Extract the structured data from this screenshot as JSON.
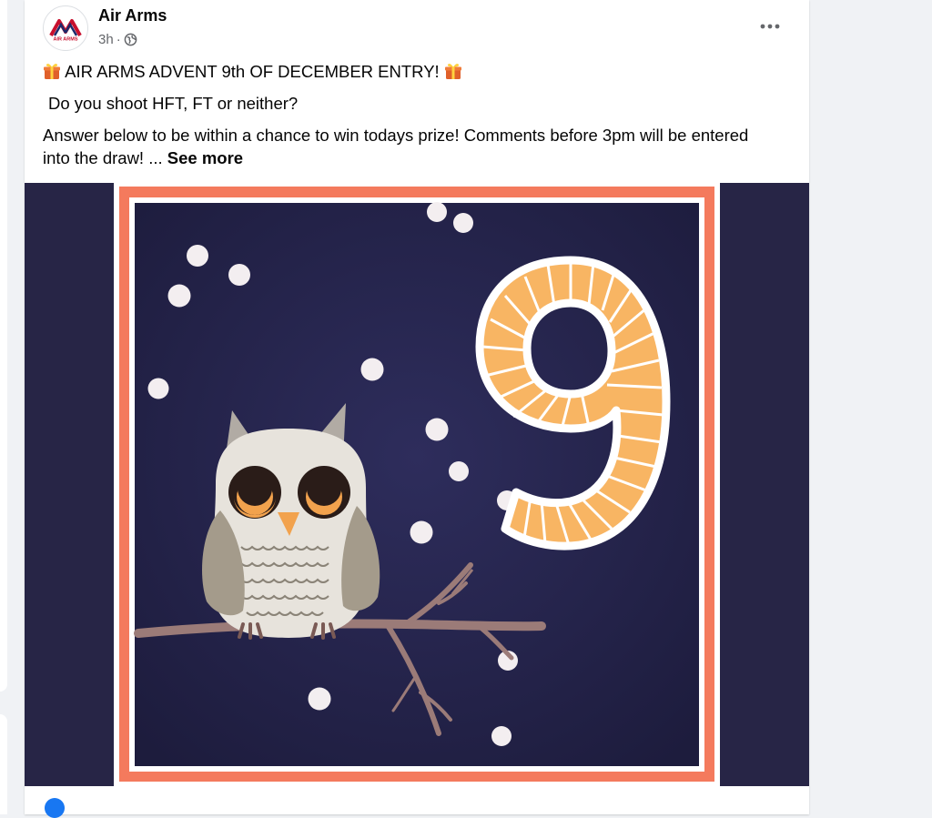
{
  "post": {
    "author": "Air Arms",
    "timestamp": "3h",
    "separator": "·",
    "audience_icon": "globe-icon",
    "more_icon": "ellipsis-icon",
    "logo_text": "AIR ARMS",
    "line1": "AIR ARMS ADVENT 9th OF DECEMBER ENTRY!",
    "line2": "Do you shoot HFT, FT  or neither?",
    "line3": "Answer below to be within a chance to win todays prize! Comments before 3pm will be entered",
    "line4": "into the draw! ...",
    "see_more": "See more",
    "emoji_icon": "gift-icon"
  },
  "image": {
    "subject": "advent-owl-number-9",
    "number": "9",
    "colors": {
      "background": "#272546",
      "inner_background": "#2a2a55",
      "frame": "#f47a5d",
      "number_fill": "#f8b563",
      "snow": "#f3eef0"
    }
  }
}
